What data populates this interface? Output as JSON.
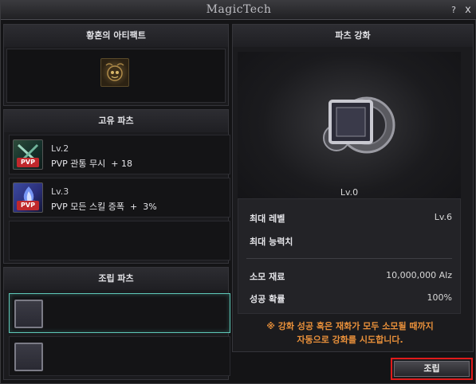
{
  "window": {
    "title": "MagicTech",
    "help_label": "?",
    "close_label": "x"
  },
  "artifact_panel": {
    "title": "황혼의 아티팩트",
    "icon": "skull-orb-icon"
  },
  "unique_parts": {
    "title": "고유 파츠",
    "items": [
      {
        "level": "Lv.2",
        "desc": "PVP 관통 무시  + 18",
        "badge": "PVP",
        "icon": "crossed-blades-icon"
      },
      {
        "level": "Lv.3",
        "desc": "PVP 모든 스킬 증폭  +  3%",
        "badge": "PVP",
        "icon": "blue-flame-icon"
      }
    ]
  },
  "assemble_parts": {
    "title": "조립 파츠"
  },
  "enhance": {
    "title": "파츠 강화",
    "level": "Lv.0",
    "stats": [
      {
        "label": "최대 레벨",
        "value": "Lv.6"
      },
      {
        "label": "최대 능력치",
        "value": ""
      },
      {
        "label": "소모 재료",
        "value": "10,000,000 Alz"
      },
      {
        "label": "성공 확률",
        "value": "100%"
      }
    ],
    "notice_line1": "※ 강화 성공 혹은 재화가 모두 소모될 때까지",
    "notice_line2": "자동으로 강화를 시도합니다."
  },
  "buttons": {
    "assemble": "조립"
  },
  "colors": {
    "accent_teal": "#5ec8b8",
    "notice_orange": "#e9903a",
    "highlight_red": "#e01b1b"
  }
}
